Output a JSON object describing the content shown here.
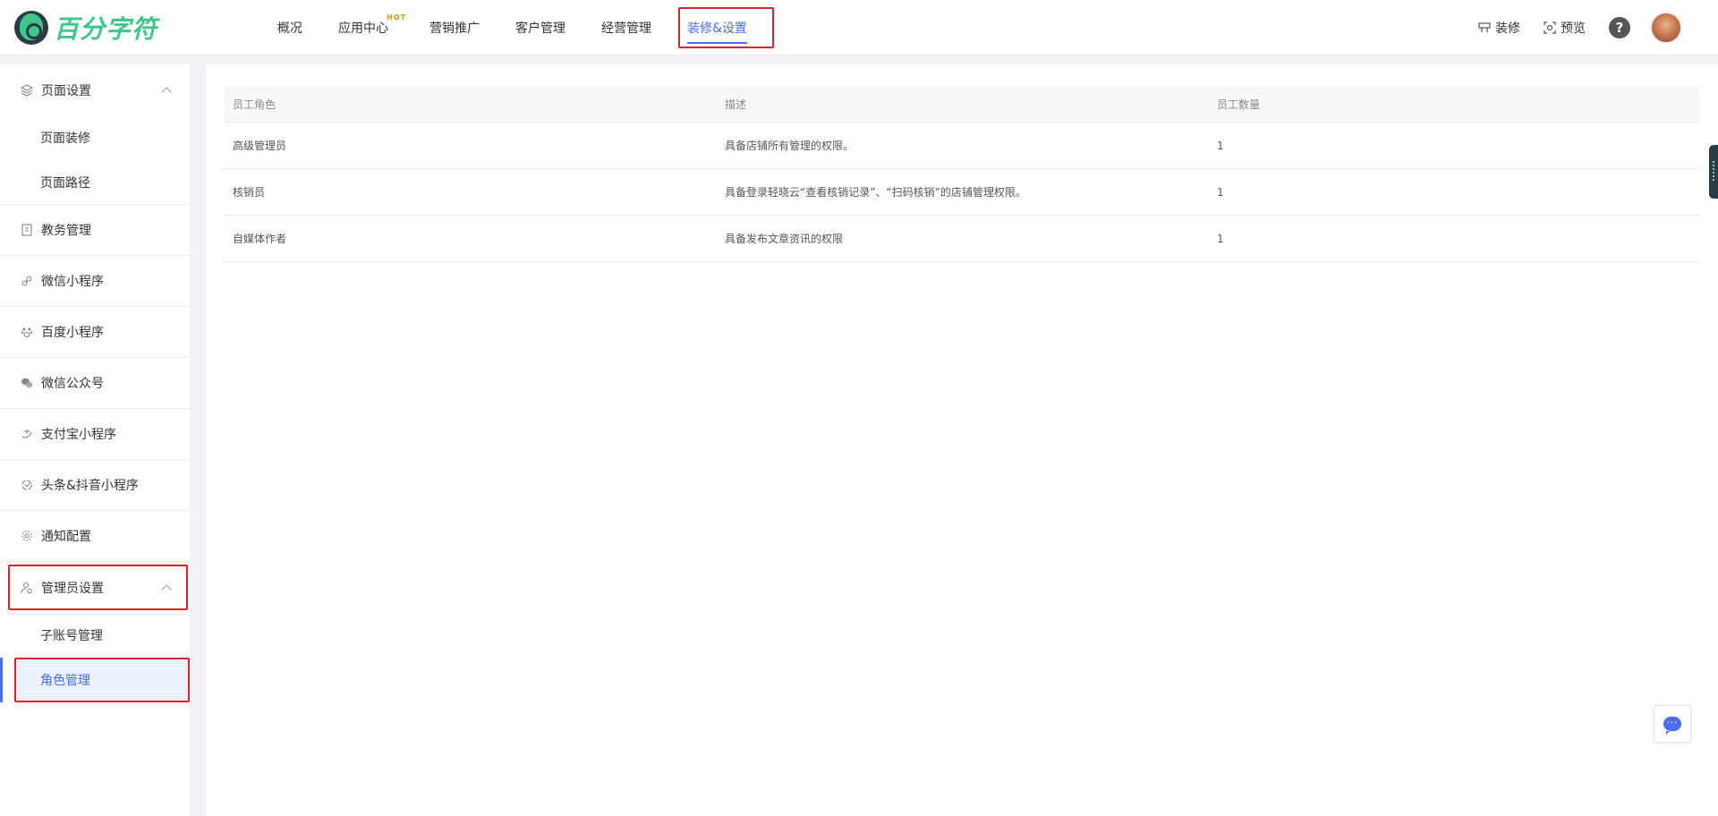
{
  "brand": {
    "name": "百分字符"
  },
  "nav": {
    "items": [
      {
        "label": "概况"
      },
      {
        "label": "应用中心",
        "badge": "HOT"
      },
      {
        "label": "营销推广"
      },
      {
        "label": "客户管理"
      },
      {
        "label": "经营管理"
      },
      {
        "label": "装修&设置",
        "active": true
      }
    ]
  },
  "top_actions": {
    "decorate": "装修",
    "preview": "预览",
    "help": "?"
  },
  "sidebar": {
    "groups": [
      {
        "label": "页面设置",
        "icon": "layers-icon",
        "expanded": true,
        "children": [
          "页面装修",
          "页面路径"
        ]
      },
      {
        "label": "教务管理",
        "icon": "document-icon"
      },
      {
        "label": "微信小程序",
        "icon": "mini-program-icon"
      },
      {
        "label": "百度小程序",
        "icon": "paw-icon"
      },
      {
        "label": "微信公众号",
        "icon": "wechat-icon"
      },
      {
        "label": "支付宝小程序",
        "icon": "alipay-icon"
      },
      {
        "label": "头条&抖音小程序",
        "icon": "bytedance-icon"
      },
      {
        "label": "通知配置",
        "icon": "gear-icon"
      },
      {
        "label": "管理员设置",
        "icon": "admin-icon",
        "expanded": true,
        "children": [
          "子账号管理",
          "角色管理"
        ],
        "active_child": "角色管理"
      }
    ]
  },
  "table": {
    "headers": [
      "员工角色",
      "描述",
      "员工数量"
    ],
    "rows": [
      {
        "role": "高级管理员",
        "desc": "具备店铺所有管理的权限。",
        "count": "1"
      },
      {
        "role": "核销员",
        "desc": "具备登录轻晓云“查看核销记录”、“扫码核销”的店铺管理权限。",
        "count": "1"
      },
      {
        "role": "自媒体作者",
        "desc": "具备发布文章资讯的权限",
        "count": "1"
      }
    ]
  },
  "colors": {
    "accent": "#4a6cf7",
    "brand": "#3ec78a",
    "highlight": "#e0202a"
  },
  "chat": {
    "icon": "chat-icon",
    "glyph": "···"
  }
}
